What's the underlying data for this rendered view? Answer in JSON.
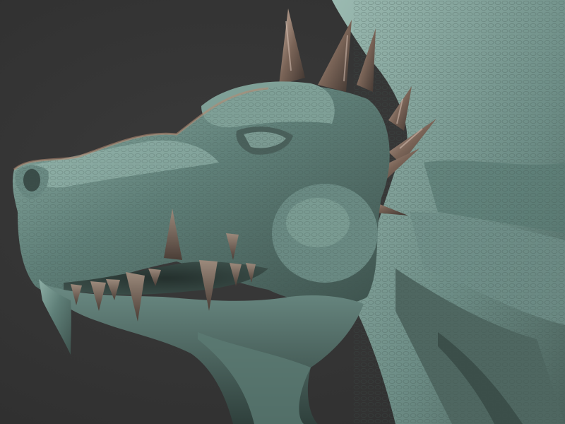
{
  "scene": {
    "subject": "dragon-head-sculpt",
    "background_color": "#333333",
    "material": {
      "base_color": "#5f7f78",
      "highlight_color": "#a9c6bd",
      "shadow_color": "#2b3a37",
      "rim_color": "#b38a73",
      "horn_color": "#6b5a50"
    }
  }
}
